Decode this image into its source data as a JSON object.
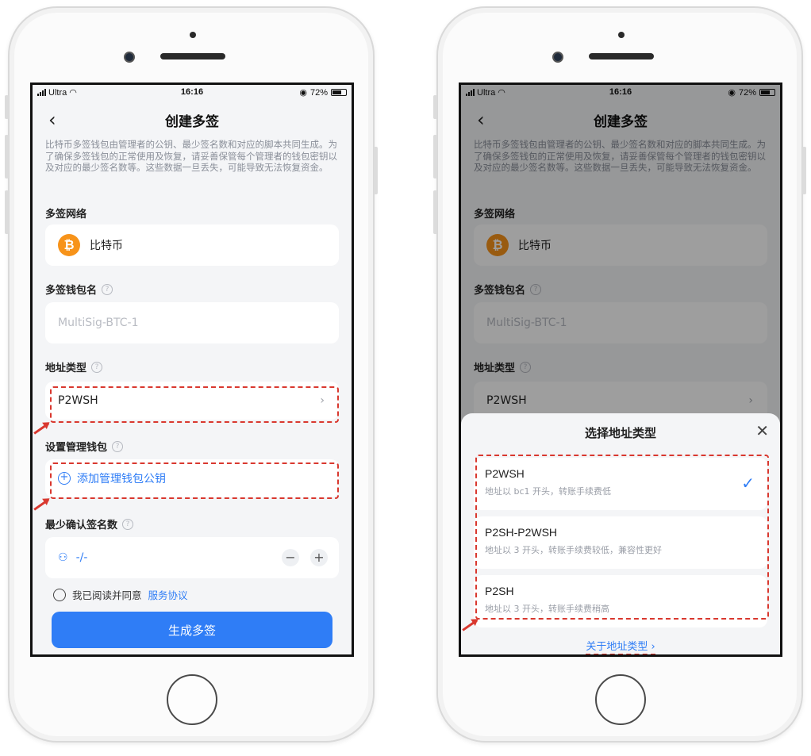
{
  "status": {
    "carrier": "Ultra",
    "time": "16:16",
    "battery": "72%"
  },
  "nav": {
    "back": "‹",
    "title": "创建多签"
  },
  "intro": "比特币多签钱包由管理者的公钥、最少签名数和对应的脚本共同生成。为了确保多签钱包的正常使用及恢复，请妥善保管每个管理者的钱包密钥以及对应的最少签名数等。这些数据一旦丢失，可能导致无法恢复资金。",
  "network": {
    "label": "多签网络",
    "value": "比特币",
    "icon": "bitcoin-icon",
    "icon_glyph": "₿",
    "color": "#f7931a"
  },
  "wallet_name": {
    "label": "多签钱包名",
    "placeholder": "MultiSig-BTC-1"
  },
  "address_type": {
    "label": "地址类型",
    "value": "P2WSH",
    "chevron": "›"
  },
  "managers": {
    "label": "设置管理钱包",
    "add": "添加管理钱包公钥",
    "add_glyph": "+"
  },
  "min_sigs": {
    "label": "最少确认签名数",
    "value": "-/-",
    "minus": "−",
    "plus": "+"
  },
  "agree": {
    "text": "我已阅读并同意",
    "link": "服务协议"
  },
  "submit": "生成多签",
  "help_glyph": "?",
  "sheet": {
    "title": "选择地址类型",
    "close": "✕",
    "options": [
      {
        "name": "P2WSH",
        "desc": "地址以 bc1 开头，转账手续费低",
        "selected": true
      },
      {
        "name": "P2SH-P2WSH",
        "desc": "地址以 3 开头，转账手续费较低，兼容性更好",
        "selected": false
      },
      {
        "name": "P2SH",
        "desc": "地址以 3 开头，转账手续费稍高",
        "selected": false
      }
    ],
    "check": "✓",
    "about": "关于地址类型 ›"
  },
  "colors": {
    "accent": "#2f7df6",
    "annotation": "#d9382f",
    "bitcoin": "#f7931a"
  }
}
